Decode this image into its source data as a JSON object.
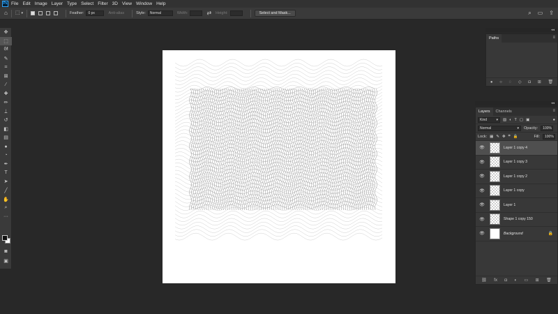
{
  "menu": {
    "app_icon": "Ps",
    "items": [
      "File",
      "Edit",
      "Image",
      "Layer",
      "Type",
      "Select",
      "Filter",
      "3D",
      "View",
      "Window",
      "Help"
    ]
  },
  "options_bar": {
    "feather_label": "Feather:",
    "feather_value": "0 px",
    "anti_alias_label": "Anti-alias",
    "style_label": "Style:",
    "style_value": "Normal",
    "width_label": "Width:",
    "height_label": "Height:",
    "select_mask_label": "Select and Mask..."
  },
  "paths_panel": {
    "tab": "Paths"
  },
  "layers_panel": {
    "tabs": [
      "Layers",
      "Channels"
    ],
    "filter_kind": "Kind",
    "blend_mode": "Normal",
    "opacity_label": "Opacity:",
    "opacity_value": "100%",
    "lock_label": "Lock:",
    "fill_label": "Fill:",
    "fill_value": "100%",
    "layers": [
      {
        "name": "Layer 1 copy 4",
        "selected": true
      },
      {
        "name": "Layer 1 copy 3",
        "selected": false
      },
      {
        "name": "Layer 1 copy 2",
        "selected": false
      },
      {
        "name": "Layer 1 copy",
        "selected": false
      },
      {
        "name": "Layer 1",
        "selected": false
      },
      {
        "name": "Shape 1 copy 150",
        "selected": false
      },
      {
        "name": "Background",
        "selected": false
      }
    ]
  },
  "icons": {
    "home": "home-icon",
    "marquee": "rect-marquee-icon",
    "search": "search-icon",
    "workspace": "workspace-icon",
    "share": "share-icon",
    "eye": "eye-icon",
    "lock": "lock-icon"
  }
}
